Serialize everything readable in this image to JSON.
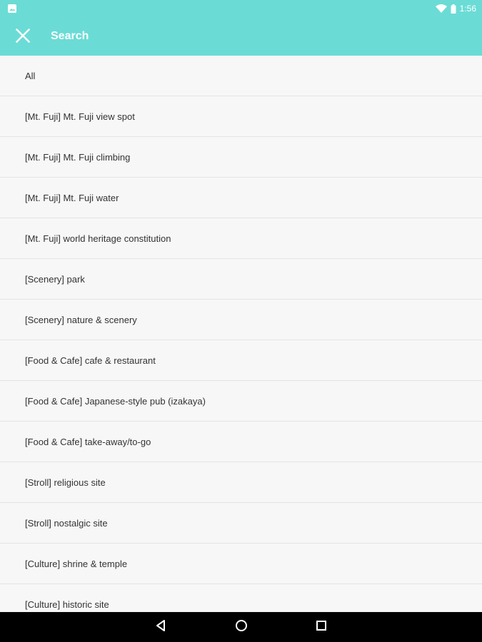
{
  "status_bar": {
    "time": "1:56",
    "icons": [
      "image-icon",
      "wifi-icon",
      "battery-icon"
    ]
  },
  "app_bar": {
    "title": "Search",
    "close_icon": "close-icon",
    "color": "#6adcd5"
  },
  "list": {
    "items": [
      {
        "label": "All"
      },
      {
        "label": "[Mt. Fuji] Mt. Fuji view spot"
      },
      {
        "label": "[Mt. Fuji] Mt. Fuji climbing"
      },
      {
        "label": "[Mt. Fuji] Mt. Fuji water"
      },
      {
        "label": "[Mt. Fuji] world heritage constitution"
      },
      {
        "label": "[Scenery] park"
      },
      {
        "label": "[Scenery] nature & scenery"
      },
      {
        "label": "[Food & Cafe] cafe & restaurant"
      },
      {
        "label": "[Food & Cafe] Japanese-style pub (izakaya)"
      },
      {
        "label": "[Food & Cafe] take-away/to-go"
      },
      {
        "label": "[Stroll] religious site"
      },
      {
        "label": "[Stroll] nostalgic site"
      },
      {
        "label": "[Culture] shrine & temple"
      },
      {
        "label": "[Culture] historic site"
      }
    ]
  },
  "nav_bar": {
    "icons": [
      "back-icon",
      "home-icon",
      "recents-icon"
    ]
  }
}
